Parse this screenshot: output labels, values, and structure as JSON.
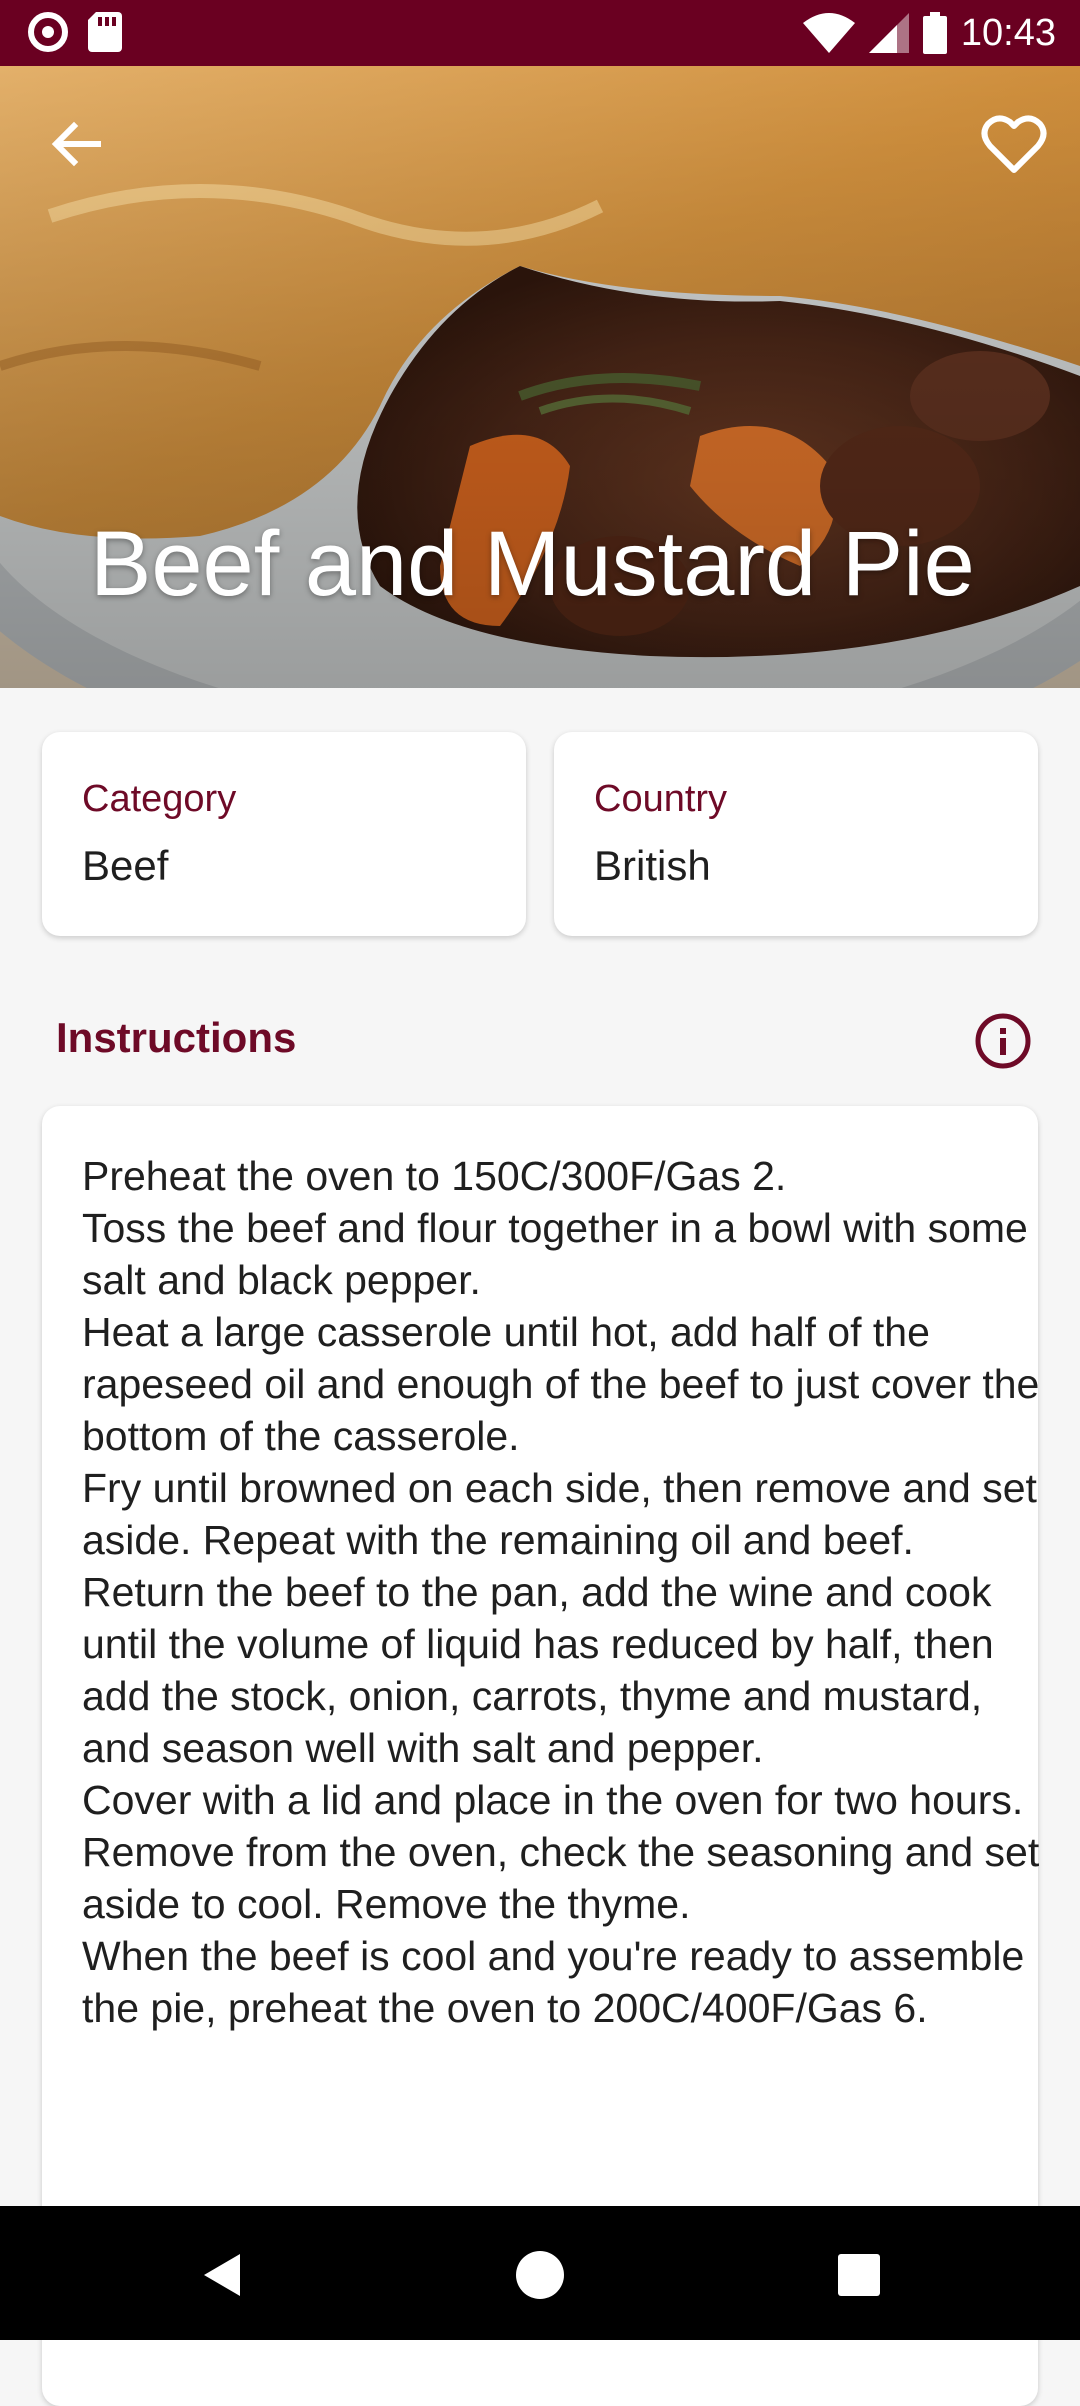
{
  "status_bar": {
    "time": "10:43",
    "left_icons": [
      "record-icon",
      "sd-card-icon"
    ],
    "right_icons": [
      "wifi-icon",
      "cell-signal-icon",
      "battery-icon"
    ]
  },
  "header": {
    "title": "Beef and Mustard Pie",
    "back_icon": "arrow-left-icon",
    "favorite_icon": "heart-outline-icon"
  },
  "info_cards": [
    {
      "label": "Category",
      "value": "Beef"
    },
    {
      "label": "Country",
      "value": "British"
    }
  ],
  "instructions": {
    "heading": "Instructions",
    "info_icon": "info-circle-icon",
    "text": "Preheat the oven to 150C/300F/Gas 2.\nToss the beef and flour together in a bowl with some salt and black pepper.\nHeat a large casserole until hot, add half of the rapeseed oil and enough of the beef to just cover the bottom of the casserole.\nFry until browned on each side, then remove and set aside. Repeat with the remaining oil and beef.\nReturn the beef to the pan, add the wine and cook until the volume of liquid has reduced by half, then add the stock, onion, carrots, thyme and mustard, and season well with salt and pepper.\nCover with a lid and place in the oven for two hours.\nRemove from the oven, check the seasoning and set aside to cool. Remove the thyme.\nWhen the beef is cool and you're ready to assemble the pie, preheat the oven to 200C/400F/Gas 6."
  },
  "nav_bar": {
    "buttons": [
      "back-triangle-icon",
      "home-circle-icon",
      "recents-square-icon"
    ]
  },
  "colors": {
    "primary_dark": "#6a0021",
    "accent": "#6e0a27",
    "background": "#f6f6f6"
  }
}
